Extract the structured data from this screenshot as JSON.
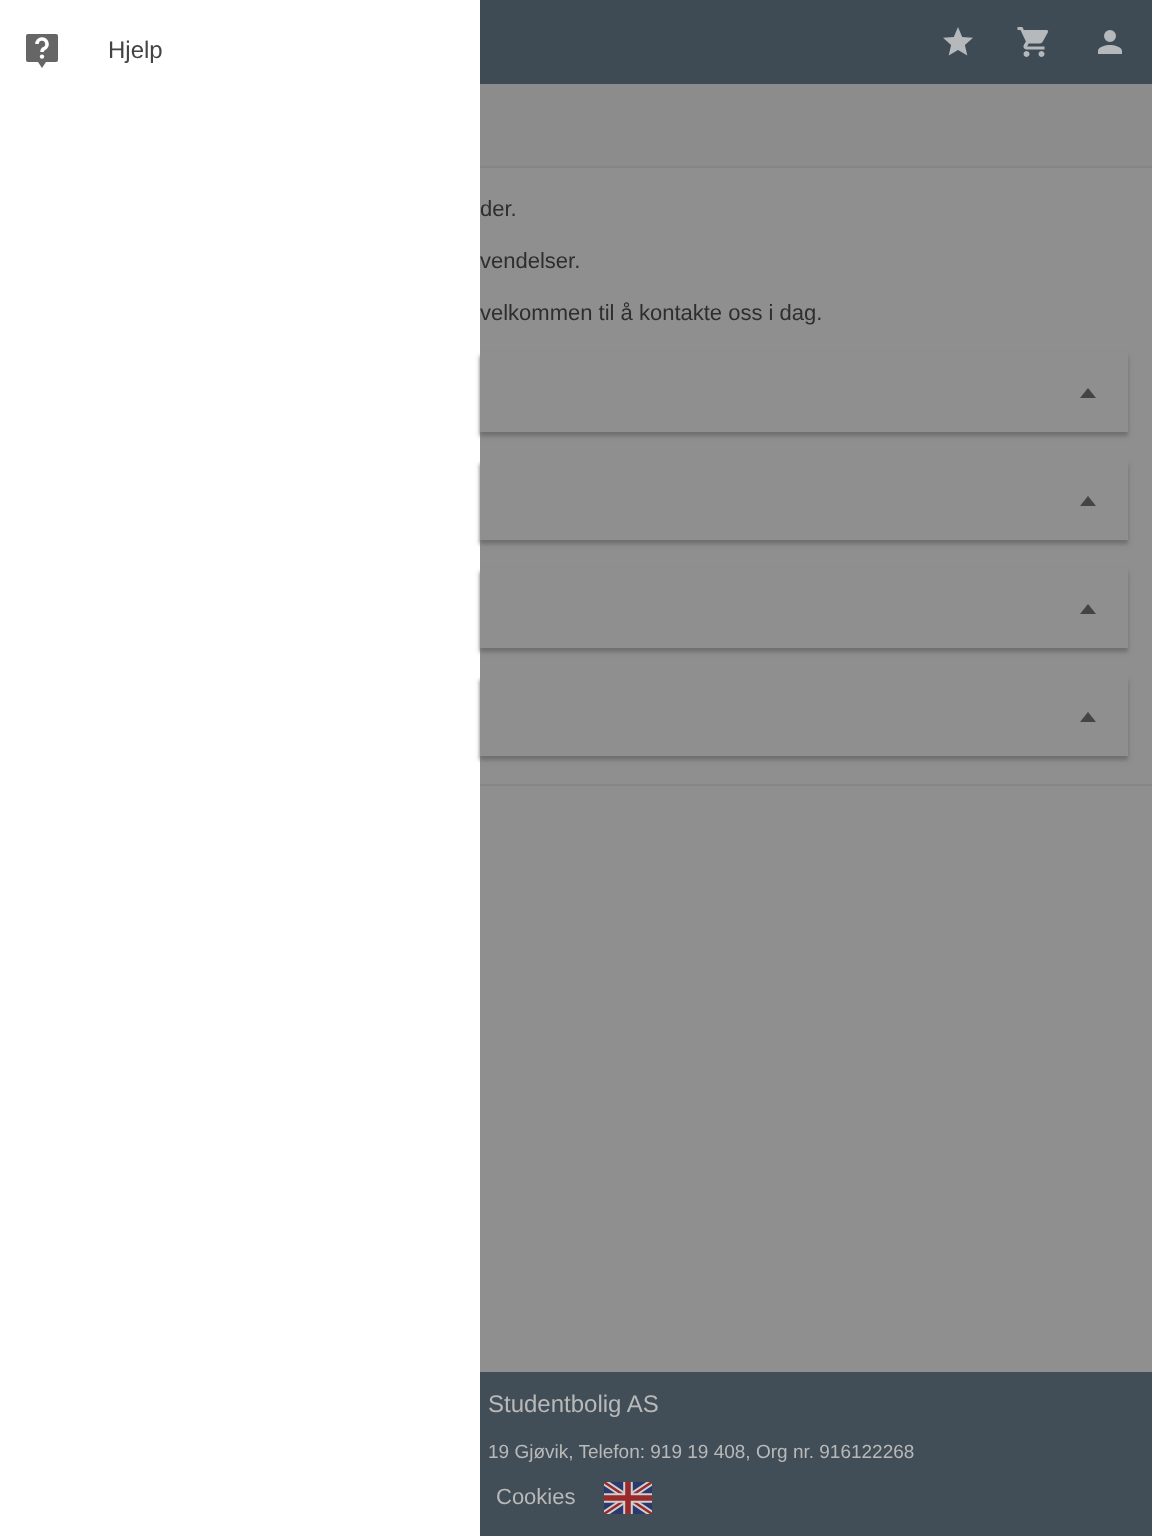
{
  "drawer": {
    "items": [
      {
        "label": "Hjelp"
      }
    ]
  },
  "page": {
    "paragraphs": [
      "der.",
      "vendelser.",
      "velkommen til å kontakte oss i dag."
    ],
    "panels": [
      {
        "kind": "panel"
      },
      {
        "kind": "panel"
      },
      {
        "kind": "panel"
      },
      {
        "kind": "panel"
      }
    ]
  },
  "footer": {
    "company": "Studentbolig AS",
    "address": "19 Gjøvik, Telefon: 919 19 408, Org nr. 916122268",
    "links": [
      "Cookies"
    ]
  }
}
